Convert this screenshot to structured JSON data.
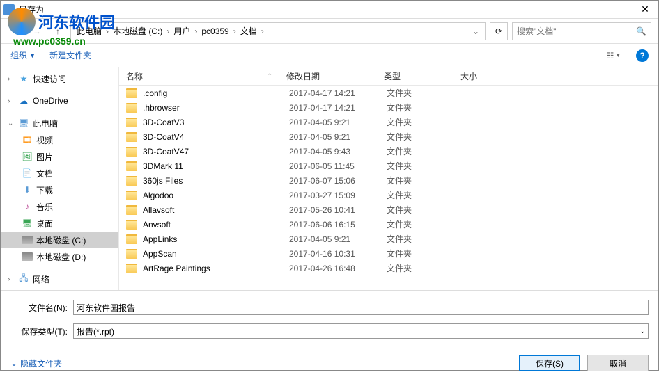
{
  "window": {
    "title": "另存为"
  },
  "watermark": {
    "brand": "河东软件园",
    "url": "www.pc0359.cn"
  },
  "breadcrumb": {
    "items": [
      "此电脑",
      "本地磁盘 (C:)",
      "用户",
      "pc0359",
      "文档"
    ]
  },
  "search": {
    "placeholder": "搜索\"文档\""
  },
  "toolbar": {
    "organize": "组织",
    "new_folder": "新建文件夹"
  },
  "sidebar": {
    "quick": "快速访问",
    "onedrive": "OneDrive",
    "thispc": "此电脑",
    "video": "视频",
    "pictures": "图片",
    "documents": "文档",
    "downloads": "下载",
    "music": "音乐",
    "desktop": "桌面",
    "drive_c": "本地磁盘 (C:)",
    "drive_d": "本地磁盘 (D:)",
    "network": "网络"
  },
  "columns": {
    "name": "名称",
    "date": "修改日期",
    "type": "类型",
    "size": "大小"
  },
  "files": [
    {
      "name": ".config",
      "date": "2017-04-17 14:21",
      "type": "文件夹"
    },
    {
      "name": ".hbrowser",
      "date": "2017-04-17 14:21",
      "type": "文件夹"
    },
    {
      "name": "3D-CoatV3",
      "date": "2017-04-05 9:21",
      "type": "文件夹"
    },
    {
      "name": "3D-CoatV4",
      "date": "2017-04-05 9:21",
      "type": "文件夹"
    },
    {
      "name": "3D-CoatV47",
      "date": "2017-04-05 9:43",
      "type": "文件夹"
    },
    {
      "name": "3DMark 11",
      "date": "2017-06-05 11:45",
      "type": "文件夹"
    },
    {
      "name": "360js Files",
      "date": "2017-06-07 15:06",
      "type": "文件夹"
    },
    {
      "name": "Algodoo",
      "date": "2017-03-27 15:09",
      "type": "文件夹"
    },
    {
      "name": "Allavsoft",
      "date": "2017-05-26 10:41",
      "type": "文件夹"
    },
    {
      "name": "Anvsoft",
      "date": "2017-06-06 16:15",
      "type": "文件夹"
    },
    {
      "name": "AppLinks",
      "date": "2017-04-05 9:21",
      "type": "文件夹"
    },
    {
      "name": "AppScan",
      "date": "2017-04-16 10:31",
      "type": "文件夹"
    },
    {
      "name": "ArtRage Paintings",
      "date": "2017-04-26 16:48",
      "type": "文件夹"
    }
  ],
  "form": {
    "filename_label": "文件名(N):",
    "filename_value": "河东软件园报告",
    "filetype_label": "保存类型(T):",
    "filetype_value": "报告(*.rpt)"
  },
  "footer": {
    "hide_folders": "隐藏文件夹",
    "save": "保存(S)",
    "cancel": "取消"
  }
}
